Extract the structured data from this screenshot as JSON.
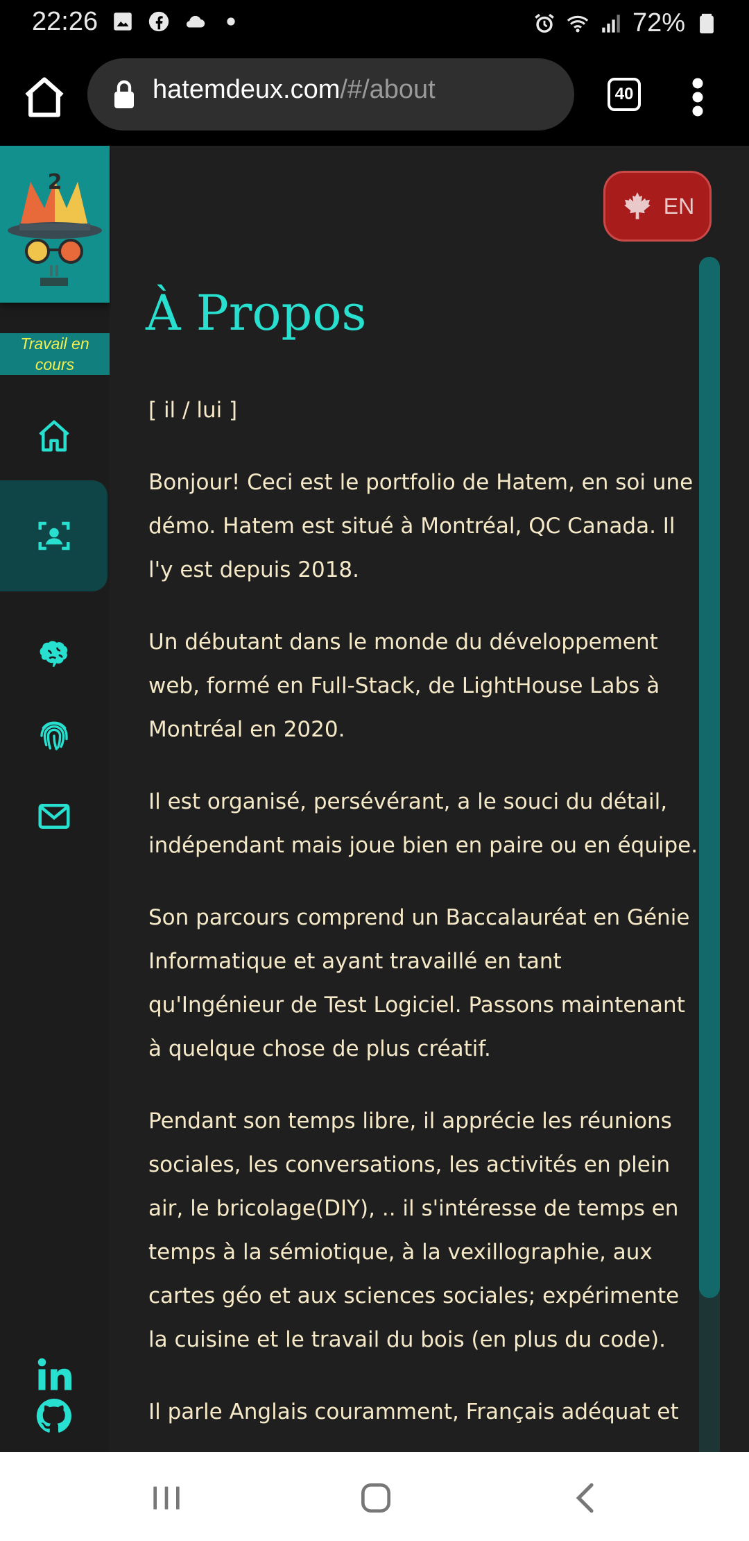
{
  "status_bar": {
    "time": "22:26",
    "battery": "72%",
    "icons": [
      "image-icon",
      "facebook-icon",
      "cloud-icon",
      "dot-icon",
      "alarm-icon",
      "wifi-icon",
      "signal-icon",
      "battery-icon"
    ]
  },
  "browser": {
    "url_domain": "hatemdeux.com",
    "url_path": "/#/about",
    "tab_count": "40"
  },
  "sidebar": {
    "badge": "Travail en cours",
    "nav": [
      {
        "name": "home",
        "icon": "home-icon",
        "active": false
      },
      {
        "name": "about",
        "icon": "user-frame-icon",
        "active": true
      },
      {
        "name": "skills",
        "icon": "brain-icon",
        "active": false
      },
      {
        "name": "identity",
        "icon": "fingerprint-icon",
        "active": false
      },
      {
        "name": "contact",
        "icon": "mail-icon",
        "active": false
      }
    ],
    "social": [
      "linkedin-icon",
      "github-icon"
    ]
  },
  "main": {
    "lang_label": "EN",
    "title": "À Propos",
    "paragraphs": [
      "[ il / lui ]",
      "Bonjour! Ceci est le portfolio de Hatem, en soi une démo. Hatem est situé à Montréal, QC Canada. Il l'y est depuis 2018.",
      "Un débutant dans le monde du développement web, formé en Full-Stack, de LightHouse Labs à Montréal en 2020.",
      "Il est organisé, persévérant, a le souci du détail, indépendant mais joue bien en paire ou en équipe.",
      "Son parcours comprend un Baccalauréat en Génie Informatique et ayant travaillé en tant qu'Ingénieur de Test Logiciel. Passons maintenant à quelque chose de plus créatif.",
      "Pendant son temps libre, il apprécie les réunions sociales, les conversations, les activités en plein air, le bricolage(DIY), .. il s'intéresse de temps en temps à la sémiotique, à la vexillographie, aux cartes géo et aux sciences sociales; expérimente la cuisine et le travail du bois (en plus du code).",
      "Il parle Anglais couramment, Français adéquat et"
    ]
  },
  "colors": {
    "accent": "#28e0cf",
    "text": "#f5e9c8",
    "badge_text": "#f1ef52",
    "lang_bg": "#a81c1c"
  }
}
